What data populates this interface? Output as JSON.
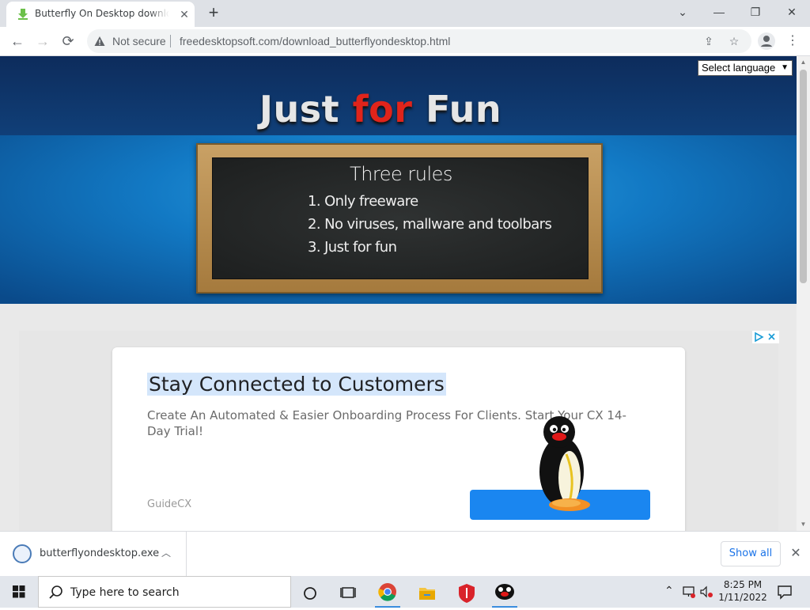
{
  "browser": {
    "tab_title": "Butterfly On Desktop download page",
    "tab_close": "✕",
    "new_tab": "+",
    "security_label": "Not secure",
    "url": "freedesktopsoft.com/download_butterflyondesktop.html",
    "nav": {
      "back": "←",
      "forward": "→",
      "reload": "⟳"
    },
    "window_controls": {
      "tab_search": "⌄",
      "minimize": "—",
      "restore": "❐",
      "close": "✕"
    },
    "menu": "⋮"
  },
  "page": {
    "language_select": "Select language",
    "hero": {
      "title_part1": "Just ",
      "title_part2": "for",
      "title_part3": " Fun"
    },
    "board": {
      "title": "Three rules",
      "rules": [
        "1. Only freeware",
        "2. No viruses, mallware and toolbars",
        "3. Just for fun"
      ]
    },
    "ad": {
      "headline": "Stay Connected to Customers",
      "description": "Create An Automated & Easier Onboarding Process For Clients. Start Your CX 14-Day Trial!",
      "brand": "GuideCX"
    }
  },
  "downloads": {
    "filename": "butterflyondesktop.exe",
    "show_all": "Show all",
    "close": "✕"
  },
  "taskbar": {
    "search_placeholder": "Type here to search",
    "time": "8:25 PM",
    "date": "1/11/2022"
  },
  "colors": {
    "accent_blue": "#1a86f0",
    "hero_blue": "#1279c4",
    "title_red": "#e0241b",
    "link_blue": "#1a73e8"
  }
}
